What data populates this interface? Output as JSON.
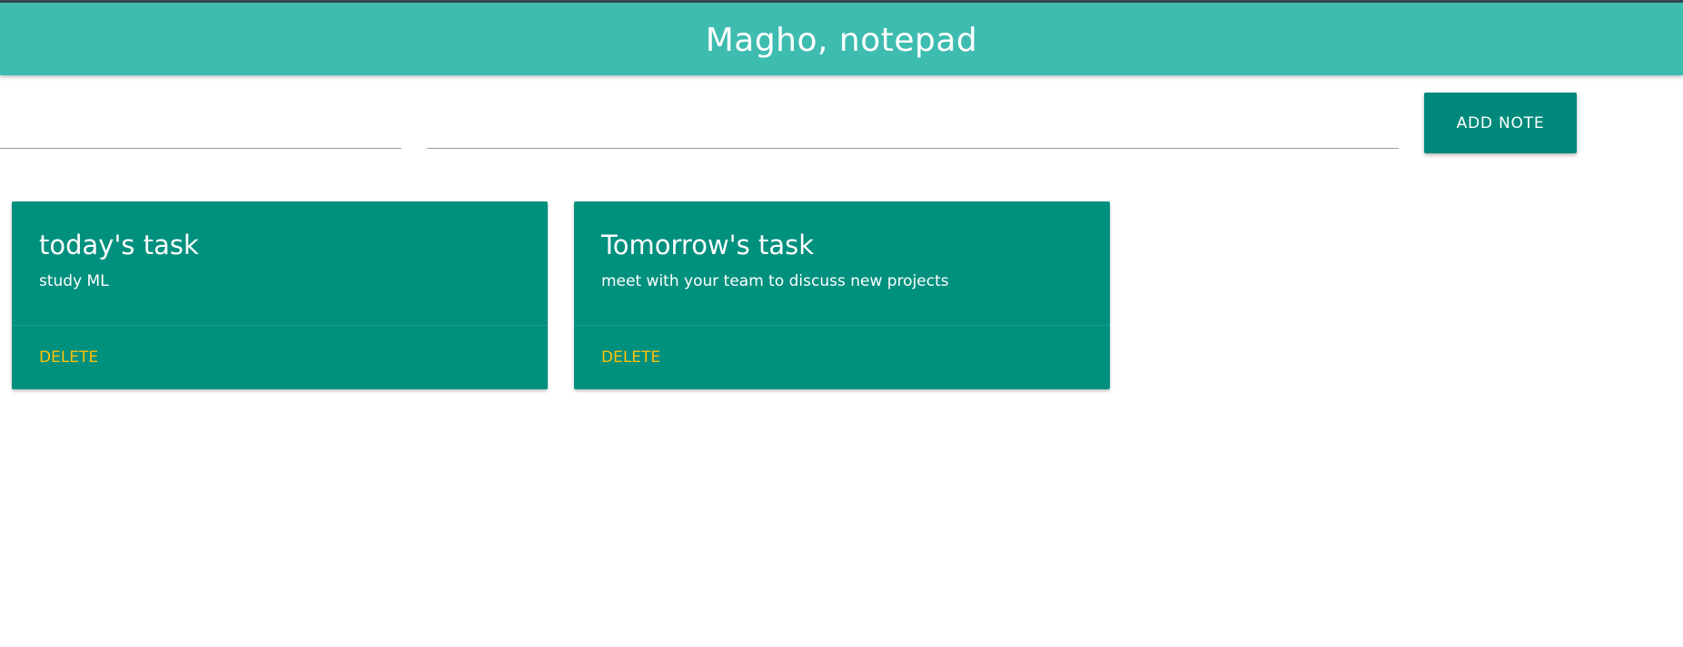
{
  "header": {
    "title": "Magho, notepad"
  },
  "form": {
    "title_value": "",
    "body_value": "",
    "add_label": "ADD NOTE"
  },
  "notes": [
    {
      "title": "today's task",
      "text": "study ML",
      "delete_label": "DELETE"
    },
    {
      "title": "Tomorrow's task",
      "text": "meet with your team to discuss new projects",
      "delete_label": "DELETE"
    }
  ],
  "colors": {
    "header_bg": "#3ebcb0",
    "card_bg": "#00907e",
    "button_bg": "#00897b",
    "delete_text": "#ffc107"
  }
}
